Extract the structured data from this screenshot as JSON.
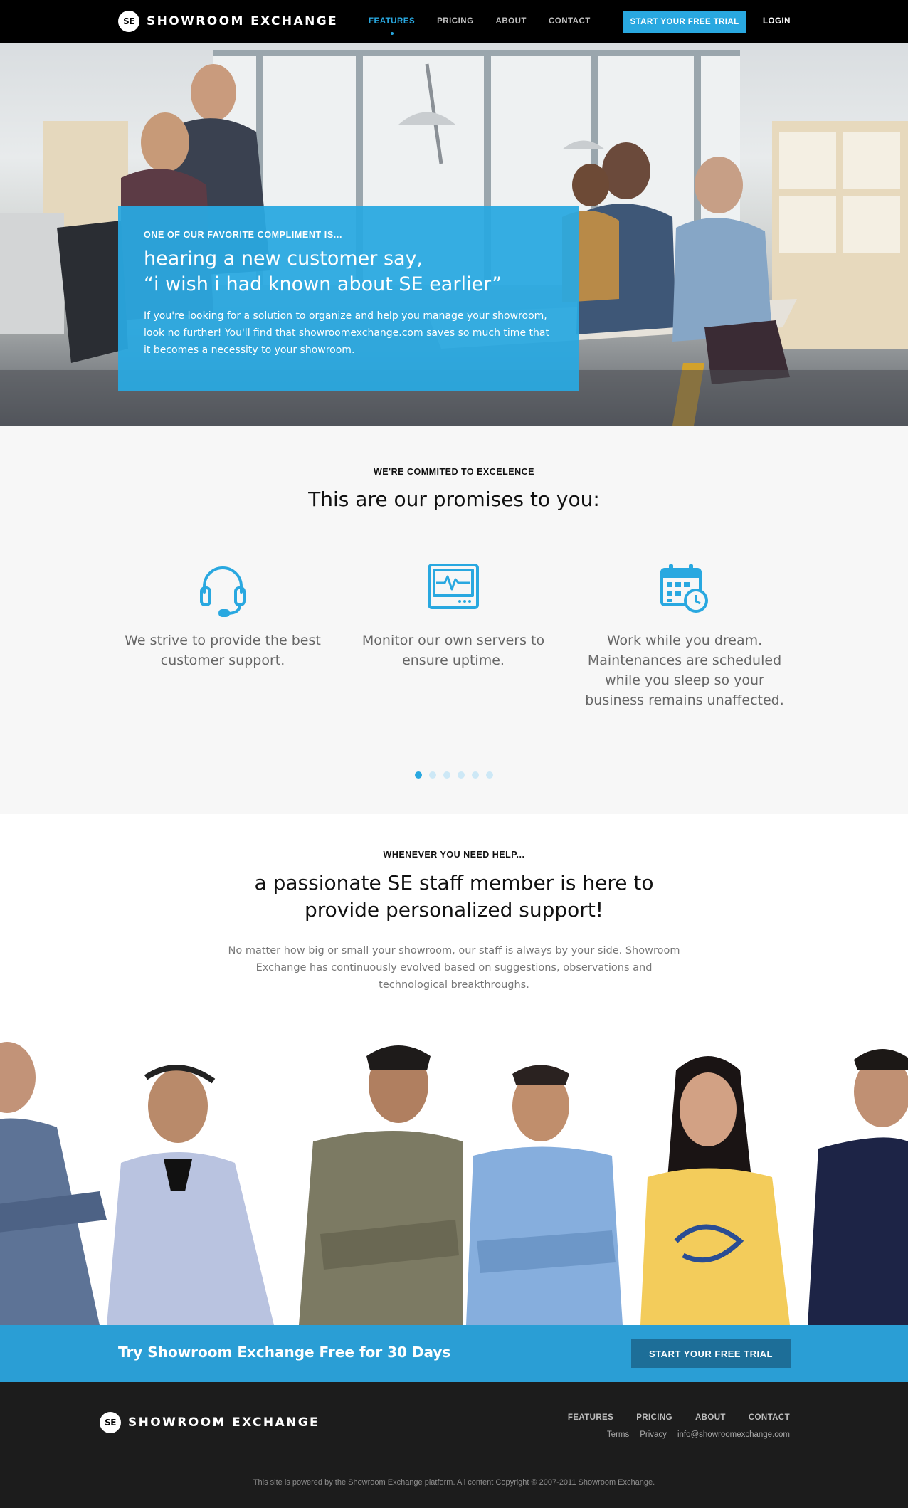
{
  "nav": {
    "logo_mark": "SE",
    "brand": "SHOWROOM EXCHANGE",
    "links": [
      {
        "label": "FEATURES",
        "active": true
      },
      {
        "label": "PRICING",
        "active": false
      },
      {
        "label": "ABOUT",
        "active": false
      },
      {
        "label": "CONTACT",
        "active": false
      }
    ],
    "cta": "START YOUR FREE TRIAL",
    "login": "LOGIN"
  },
  "hero": {
    "kicker": "ONE OF OUR FAVORITE COMPLIMENT IS...",
    "title_line1": "hearing a new customer say,",
    "title_line2": "“i wish i had known about SE earlier”",
    "text": "If you're looking for a solution to organize and help you manage your showroom, look no further! You'll find that showroomexchange.com saves so much time that it becomes a necessity to your showroom."
  },
  "promises": {
    "kicker": "WE'RE COMMITED TO EXCELENCE",
    "title": "This are our promises to you:",
    "features": [
      {
        "icon": "headset-icon",
        "text": "We strive to provide the best customer support."
      },
      {
        "icon": "monitor-icon",
        "text": "Monitor our own servers to ensure uptime."
      },
      {
        "icon": "calendar-clock-icon",
        "text": "Work while you dream. Maintenances are scheduled while you sleep so your business remains unaffected."
      }
    ],
    "pager": {
      "count": 6,
      "active_index": 0
    }
  },
  "support": {
    "kicker": "WHENEVER YOU NEED HELP...",
    "title_line1": "a passionate SE staff member is here to",
    "title_line2": "provide personalized support!",
    "text": "No matter how big or small your showroom, our staff is always by your side. Showroom Exchange has continuously evolved based on suggestions, observations and technological breakthroughs."
  },
  "cta_bar": {
    "text": "Try Showroom Exchange Free for 30 Days",
    "button": "START YOUR FREE TRIAL"
  },
  "footer": {
    "logo_mark": "SE",
    "brand": "SHOWROOM EXCHANGE",
    "nav": [
      "FEATURES",
      "PRICING",
      "ABOUT",
      "CONTACT"
    ],
    "links": [
      "Terms",
      "Privacy",
      "info@showroomexchange.com"
    ],
    "copyright": "This site is powered by the Showroom Exchange platform.  All content Copyright © 2007-2011 Showroom Exchange."
  },
  "colors": {
    "accent": "#29a8e0",
    "nav_bg": "#000000",
    "cta_bar": "#2a9ed5",
    "cta_button": "#1d6e98",
    "footer_bg": "#1c1c1c"
  }
}
